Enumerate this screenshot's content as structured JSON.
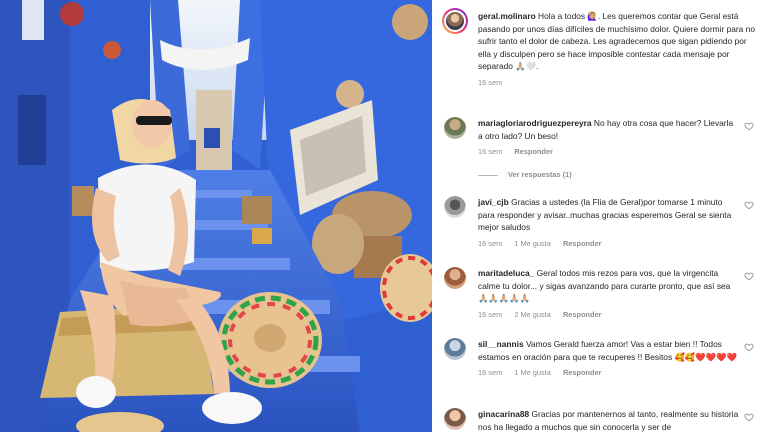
{
  "post": {
    "author": "geral.molinaro",
    "caption": "Hola a todos 🙋🏼‍♀️. Les queremos contar que Geral está pasando por unos días difíciles de muchísimo dolor. Quiere dormir para no sufrir tanto el dolor de cabeza. Les agradecemos que sigan pidiendo por ella y disculpen pero se hace imposible contestar cada mensaje por separado 🙏🏼🤍.",
    "time": "16 sem"
  },
  "comments": [
    {
      "username": "mariagloriarodriguezpereyra",
      "text": "No hay otra cosa que hacer? Llevarla a otro lado? Un beso!",
      "time": "16 sem",
      "likes": "",
      "reply_label": "Responder",
      "view_replies": "Ver respuestas (1)"
    },
    {
      "username": "javi_cjb",
      "text": "Gracias a ustedes (la Flia de Geral)por tomarse 1 minuto para responder y avisar..muchas gracias esperemos Geral se sienta mejor saludos",
      "time": "16 sem",
      "likes": "1 Me gusta",
      "reply_label": "Responder"
    },
    {
      "username": "maritadeluca_",
      "text": "Geral todos mis rezos para vos, que la virgencita calme tu dolor... y sigas avanzando para curarte pronto, que así sea 🙏🏼🙏🏼🙏🏼🙏🏼🙏🏼",
      "time": "16 sem",
      "likes": "2 Me gusta",
      "reply_label": "Responder"
    },
    {
      "username": "sil__nannis",
      "text": "Vamos Gerald fuerza amor! Vas a estar bien !! Todos estamos en oración para que te recuperes !! Besitos 🥰🥰❤️❤️❤️❤️",
      "time": "16 sem",
      "likes": "1 Me gusta",
      "reply_label": "Responder"
    },
    {
      "username": "ginacarina88",
      "text": "Gracias por mantenernos al tanto, realmente su historia nos ha llegado a muchos que sin conocerla y ser de",
      "time": "",
      "likes": "",
      "reply_label": ""
    }
  ],
  "colors": {
    "wall_blue": "#2f5fd0",
    "text": "#262626",
    "muted": "#8e8e8e"
  },
  "icons": {
    "like": "heart-icon"
  }
}
